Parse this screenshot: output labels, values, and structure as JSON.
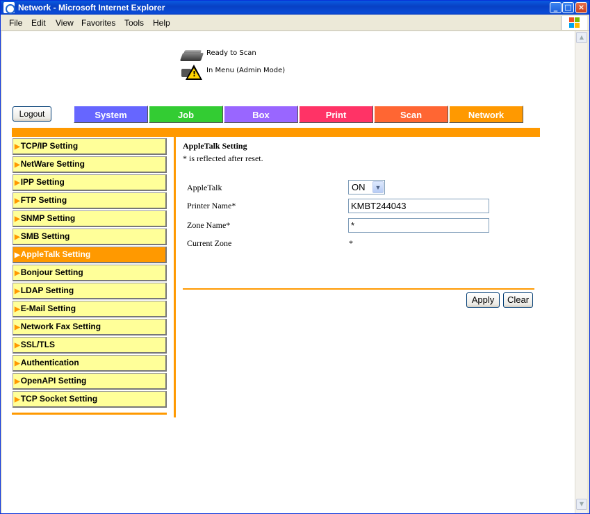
{
  "window": {
    "title": "Network - Microsoft Internet Explorer"
  },
  "menu": [
    "File",
    "Edit",
    "View",
    "Favorites",
    "Tools",
    "Help"
  ],
  "status": {
    "line1": "Ready to Scan",
    "line2": "In Menu (Admin Mode)"
  },
  "logout_label": "Logout",
  "tabs": [
    {
      "label": "System",
      "color": "#6666ff"
    },
    {
      "label": "Job",
      "color": "#33cc33"
    },
    {
      "label": "Box",
      "color": "#9966ff"
    },
    {
      "label": "Print",
      "color": "#ff3366"
    },
    {
      "label": "Scan",
      "color": "#ff6633"
    },
    {
      "label": "Network",
      "color": "#ff9900"
    }
  ],
  "sidebar": [
    "TCP/IP Setting",
    "NetWare Setting",
    "IPP Setting",
    "FTP Setting",
    "SNMP Setting",
    "SMB Setting",
    "AppleTalk Setting",
    "Bonjour Setting",
    "LDAP Setting",
    "E-Mail Setting",
    "Network Fax Setting",
    "SSL/TLS",
    "Authentication",
    "OpenAPI Setting",
    "TCP Socket Setting"
  ],
  "sidebar_active_index": 6,
  "content": {
    "title": "AppleTalk Setting",
    "note": "* is reflected after reset.",
    "fields": {
      "appletalk": {
        "label": "AppleTalk",
        "value": "ON"
      },
      "printer_name": {
        "label": "Printer Name*",
        "value": "KMBT244043"
      },
      "zone_name": {
        "label": "Zone Name*",
        "value": "*"
      },
      "current_zone": {
        "label": "Current Zone",
        "value": "*"
      }
    },
    "apply_label": "Apply",
    "clear_label": "Clear"
  }
}
